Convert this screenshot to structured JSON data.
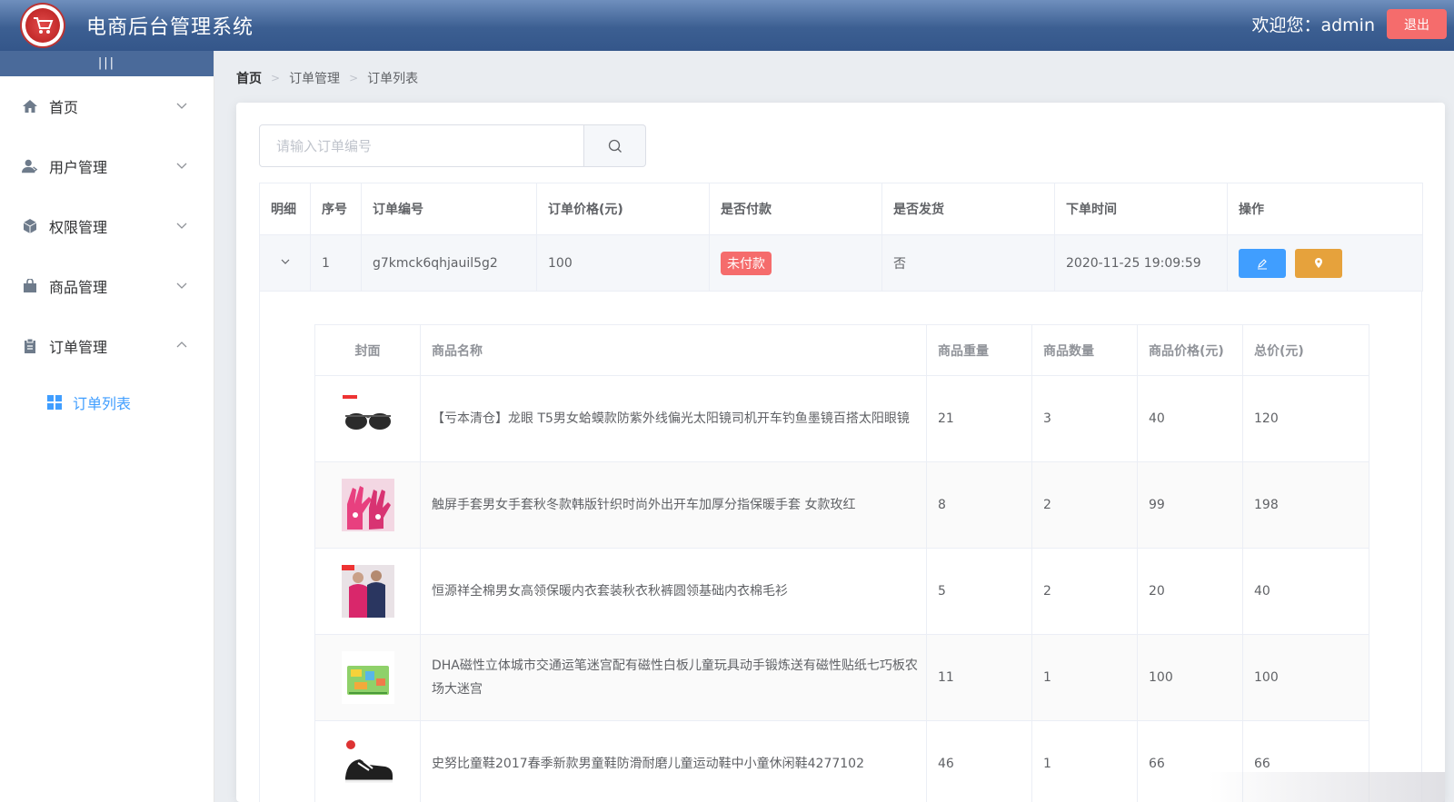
{
  "header": {
    "title": "电商后台管理系统",
    "welcome": "欢迎您：admin",
    "logout_label": "退出"
  },
  "sidebar": {
    "toggle": "|||",
    "items": [
      {
        "label": "首页",
        "icon": "home-icon"
      },
      {
        "label": "用户管理",
        "icon": "user-icon"
      },
      {
        "label": "权限管理",
        "icon": "box-icon"
      },
      {
        "label": "商品管理",
        "icon": "bag-icon"
      },
      {
        "label": "订单管理",
        "icon": "clipboard-icon"
      }
    ],
    "sub_item": {
      "label": "订单列表",
      "icon": "grid-icon"
    }
  },
  "breadcrumb": [
    "首页",
    "订单管理",
    "订单列表"
  ],
  "search": {
    "placeholder": "请输入订单编号"
  },
  "orders": {
    "headers": [
      "明细",
      "序号",
      "订单编号",
      "订单价格(元)",
      "是否付款",
      "是否发货",
      "下单时间",
      "操作"
    ],
    "row": {
      "index": "1",
      "number": "g7kmck6qhjauil5g2",
      "price": "100",
      "paid": "未付款",
      "shipped": "否",
      "time": "2020-11-25 19:09:59"
    }
  },
  "goods": {
    "headers": [
      "封面",
      "商品名称",
      "商品重量",
      "商品数量",
      "商品价格(元)",
      "总价(元)"
    ],
    "rows": [
      {
        "name": "【亏本清仓】龙眼 T5男女蛤蟆款防紫外线偏光太阳镜司机开车钓鱼墨镜百搭太阳眼镜",
        "weight": "21",
        "qty": "3",
        "price": "40",
        "total": "120",
        "thumb": "sunglasses"
      },
      {
        "name": "触屏手套男女手套秋冬款韩版针织时尚外出开车加厚分指保暖手套 女款玫红",
        "weight": "8",
        "qty": "2",
        "price": "99",
        "total": "198",
        "thumb": "gloves"
      },
      {
        "name": "恒源祥全棉男女高领保暖内衣套装秋衣秋裤圆领基础内衣棉毛衫",
        "weight": "5",
        "qty": "2",
        "price": "20",
        "total": "40",
        "thumb": "underwear"
      },
      {
        "name": "DHA磁性立体城市交通运笔迷宫配有磁性白板儿童玩具动手锻炼送有磁性贴纸七巧板农场大迷宫",
        "weight": "11",
        "qty": "1",
        "price": "100",
        "total": "100",
        "thumb": "maze-toy"
      },
      {
        "name": "史努比童鞋2017春季新款男童鞋防滑耐磨儿童运动鞋中小童休闲鞋4277102",
        "weight": "46",
        "qty": "1",
        "price": "66",
        "total": "66",
        "thumb": "shoes"
      }
    ]
  }
}
